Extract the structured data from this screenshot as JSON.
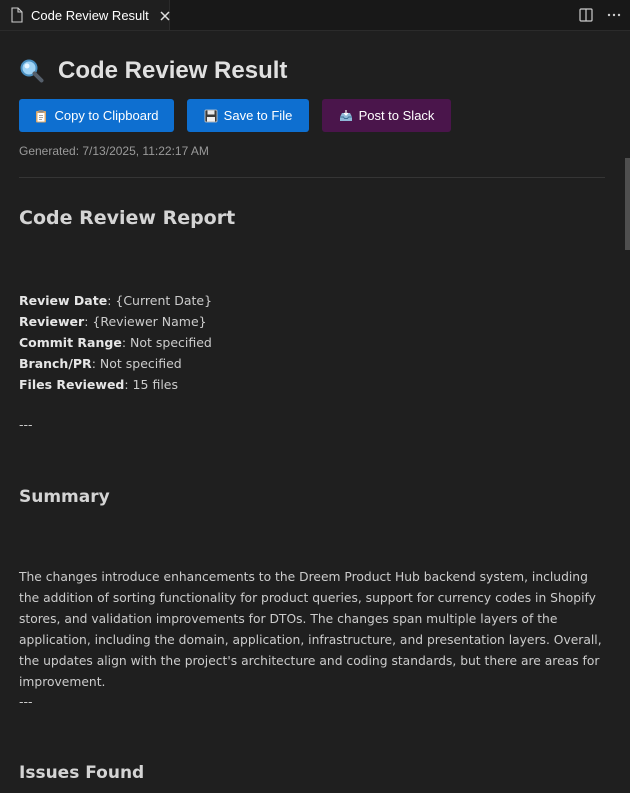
{
  "tab": {
    "title": "Code Review Result",
    "icons": {
      "file": "file-icon",
      "close": "close-icon",
      "split": "split-editor-icon",
      "more": "more-actions-icon"
    }
  },
  "header": {
    "title": "Code Review Result",
    "title_icon": "magnifier-icon",
    "buttons": {
      "copy": "Copy to Clipboard",
      "save": "Save to File",
      "slack": "Post to Slack"
    },
    "button_icons": {
      "copy": "clipboard-icon",
      "save": "floppy-disk-icon",
      "slack": "inbox-tray-icon"
    },
    "generated": "Generated: 7/13/2025, 11:22:17 AM"
  },
  "report": {
    "title": "Code Review Report",
    "meta": [
      {
        "label": "Review Date",
        "value": ": {Current Date}"
      },
      {
        "label": "Reviewer",
        "value": ": {Reviewer Name}"
      },
      {
        "label": "Commit Range",
        "value": ": Not specified"
      },
      {
        "label": "Branch/PR",
        "value": ": Not specified"
      },
      {
        "label": "Files Reviewed",
        "value": ": 15 files"
      }
    ],
    "separator": "---",
    "summary_title": "Summary",
    "summary_text": "The changes introduce enhancements to the Dreem Product Hub backend system, including the addition of sorting functionality for product queries, support for currency codes in Shopify stores, and validation improvements for DTOs. The changes span multiple layers of the application, including the domain, application, infrastructure, and presentation layers. Overall, the updates align with the project's architecture and coding standards, but there are areas for improvement.",
    "issues_title": "Issues Found"
  },
  "colors": {
    "background": "#1f1f1f",
    "primary_button": "#0e6fd0",
    "slack_button": "#4a154b"
  }
}
